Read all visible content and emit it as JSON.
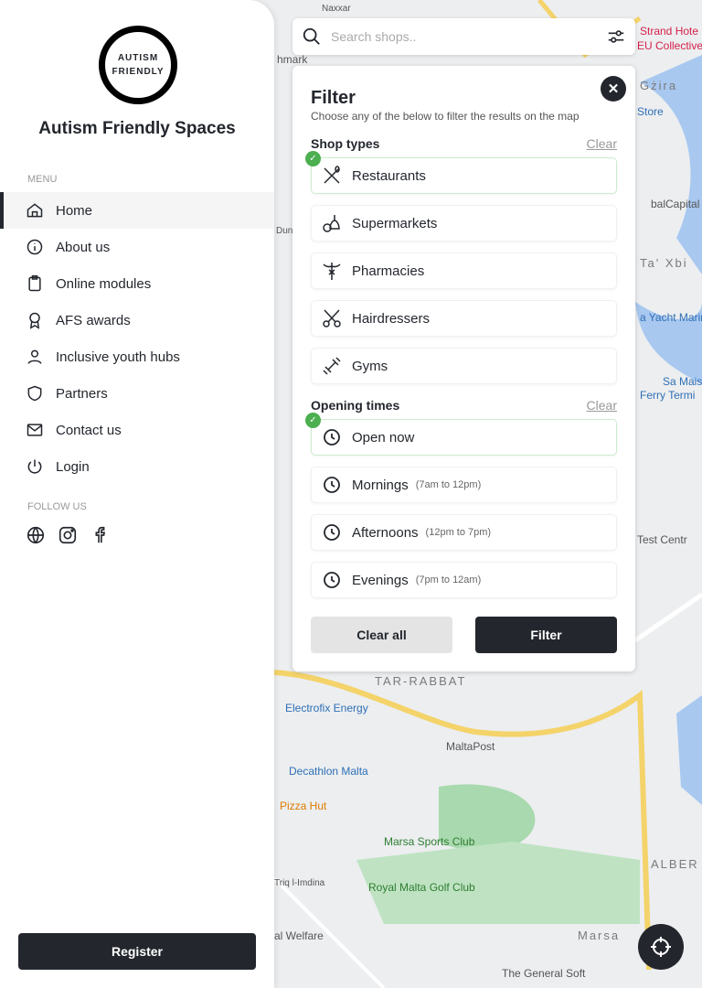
{
  "app": {
    "title": "Autism Friendly Spaces",
    "logo_text": [
      "AUTISM",
      "FRIENDLY"
    ]
  },
  "sidebar": {
    "menu_label": "MENU",
    "items": [
      {
        "label": "Home",
        "icon": "home-icon",
        "active": true
      },
      {
        "label": "About us",
        "icon": "info-icon"
      },
      {
        "label": "Online modules",
        "icon": "clipboard-icon"
      },
      {
        "label": "AFS awards",
        "icon": "award-icon"
      },
      {
        "label": "Inclusive youth hubs",
        "icon": "user-icon"
      },
      {
        "label": "Partners",
        "icon": "shield-icon"
      },
      {
        "label": "Contact us",
        "icon": "mail-icon"
      },
      {
        "label": "Login",
        "icon": "power-icon"
      }
    ],
    "follow_label": "FOLLOW US",
    "social": [
      "globe-icon",
      "instagram-icon",
      "facebook-icon"
    ],
    "register_label": "Register"
  },
  "search": {
    "placeholder": "Search shops.."
  },
  "filter": {
    "title": "Filter",
    "subtitle": "Choose any of the below to filter the results on the map",
    "shop_types": {
      "heading": "Shop types",
      "clear": "Clear",
      "options": [
        {
          "label": "Restaurants",
          "selected": true,
          "icon": "utensils-icon"
        },
        {
          "label": "Supermarkets",
          "selected": false,
          "icon": "groceries-icon"
        },
        {
          "label": "Pharmacies",
          "selected": false,
          "icon": "caduceus-icon"
        },
        {
          "label": "Hairdressers",
          "selected": false,
          "icon": "scissors-icon"
        },
        {
          "label": "Gyms",
          "selected": false,
          "icon": "dumbbell-icon"
        }
      ]
    },
    "opening_times": {
      "heading": "Opening times",
      "clear": "Clear",
      "options": [
        {
          "label": "Open now",
          "hours": "",
          "selected": true
        },
        {
          "label": "Mornings",
          "hours": "(7am to 12pm)"
        },
        {
          "label": "Afternoons",
          "hours": "(12pm to 7pm)"
        },
        {
          "label": "Evenings",
          "hours": "(7pm to 12am)"
        }
      ]
    },
    "clear_all": "Clear all",
    "apply": "Filter"
  },
  "map": {
    "labels": {
      "strand": "Strand Hote",
      "eu": "EU Collective",
      "gzira": "Gżira",
      "store": "Store",
      "balcap": "balCapital p",
      "taxbiex": "Ta' Xbi",
      "marina": "a Yacht Marina",
      "samais": "Sa Mais",
      "ferry": "Ferry Termi",
      "test": "Test Centr",
      "tarrabat": "TAR-RABBAT",
      "electrofix": "Electrofix Energy",
      "maltapost": "MaltaPost",
      "decathlon": "Decathlon Malta",
      "pizza": "Pizza Hut",
      "marsasports": "Marsa Sports Club",
      "golf": "Royal Malta Golf Club",
      "alber": "ALBER",
      "marsa": "Marsa",
      "welfare": "al Welfare",
      "general": "The General Soft",
      "imdina": "Triq l-Imdina",
      "naxxar": "Naxxar",
      "hmark": "hmark",
      "dunfen": "Dun Fen"
    }
  }
}
